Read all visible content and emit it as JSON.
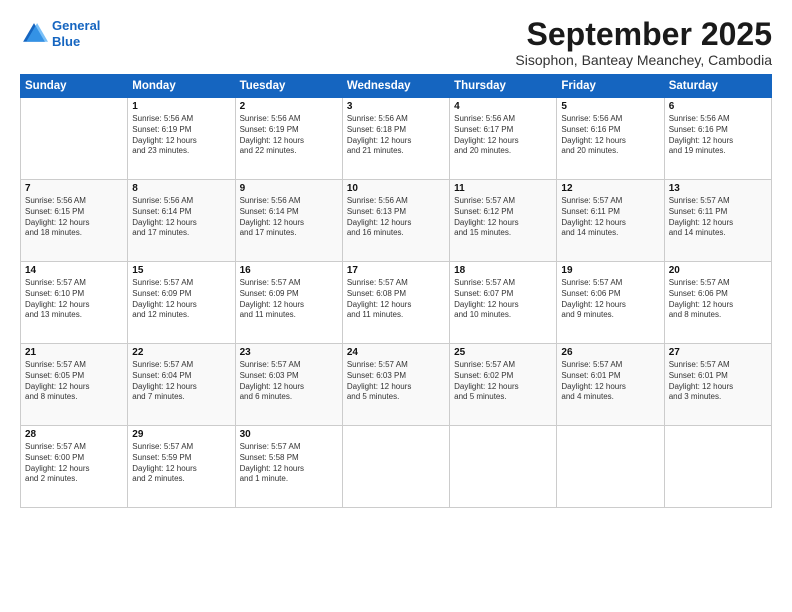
{
  "logo": {
    "line1": "General",
    "line2": "Blue"
  },
  "title": "September 2025",
  "subtitle": "Sisophon, Banteay Meanchey, Cambodia",
  "days_header": [
    "Sunday",
    "Monday",
    "Tuesday",
    "Wednesday",
    "Thursday",
    "Friday",
    "Saturday"
  ],
  "weeks": [
    [
      {
        "day": "",
        "info": ""
      },
      {
        "day": "1",
        "info": "Sunrise: 5:56 AM\nSunset: 6:19 PM\nDaylight: 12 hours\nand 23 minutes."
      },
      {
        "day": "2",
        "info": "Sunrise: 5:56 AM\nSunset: 6:19 PM\nDaylight: 12 hours\nand 22 minutes."
      },
      {
        "day": "3",
        "info": "Sunrise: 5:56 AM\nSunset: 6:18 PM\nDaylight: 12 hours\nand 21 minutes."
      },
      {
        "day": "4",
        "info": "Sunrise: 5:56 AM\nSunset: 6:17 PM\nDaylight: 12 hours\nand 20 minutes."
      },
      {
        "day": "5",
        "info": "Sunrise: 5:56 AM\nSunset: 6:16 PM\nDaylight: 12 hours\nand 20 minutes."
      },
      {
        "day": "6",
        "info": "Sunrise: 5:56 AM\nSunset: 6:16 PM\nDaylight: 12 hours\nand 19 minutes."
      }
    ],
    [
      {
        "day": "7",
        "info": "Sunrise: 5:56 AM\nSunset: 6:15 PM\nDaylight: 12 hours\nand 18 minutes."
      },
      {
        "day": "8",
        "info": "Sunrise: 5:56 AM\nSunset: 6:14 PM\nDaylight: 12 hours\nand 17 minutes."
      },
      {
        "day": "9",
        "info": "Sunrise: 5:56 AM\nSunset: 6:14 PM\nDaylight: 12 hours\nand 17 minutes."
      },
      {
        "day": "10",
        "info": "Sunrise: 5:56 AM\nSunset: 6:13 PM\nDaylight: 12 hours\nand 16 minutes."
      },
      {
        "day": "11",
        "info": "Sunrise: 5:57 AM\nSunset: 6:12 PM\nDaylight: 12 hours\nand 15 minutes."
      },
      {
        "day": "12",
        "info": "Sunrise: 5:57 AM\nSunset: 6:11 PM\nDaylight: 12 hours\nand 14 minutes."
      },
      {
        "day": "13",
        "info": "Sunrise: 5:57 AM\nSunset: 6:11 PM\nDaylight: 12 hours\nand 14 minutes."
      }
    ],
    [
      {
        "day": "14",
        "info": "Sunrise: 5:57 AM\nSunset: 6:10 PM\nDaylight: 12 hours\nand 13 minutes."
      },
      {
        "day": "15",
        "info": "Sunrise: 5:57 AM\nSunset: 6:09 PM\nDaylight: 12 hours\nand 12 minutes."
      },
      {
        "day": "16",
        "info": "Sunrise: 5:57 AM\nSunset: 6:09 PM\nDaylight: 12 hours\nand 11 minutes."
      },
      {
        "day": "17",
        "info": "Sunrise: 5:57 AM\nSunset: 6:08 PM\nDaylight: 12 hours\nand 11 minutes."
      },
      {
        "day": "18",
        "info": "Sunrise: 5:57 AM\nSunset: 6:07 PM\nDaylight: 12 hours\nand 10 minutes."
      },
      {
        "day": "19",
        "info": "Sunrise: 5:57 AM\nSunset: 6:06 PM\nDaylight: 12 hours\nand 9 minutes."
      },
      {
        "day": "20",
        "info": "Sunrise: 5:57 AM\nSunset: 6:06 PM\nDaylight: 12 hours\nand 8 minutes."
      }
    ],
    [
      {
        "day": "21",
        "info": "Sunrise: 5:57 AM\nSunset: 6:05 PM\nDaylight: 12 hours\nand 8 minutes."
      },
      {
        "day": "22",
        "info": "Sunrise: 5:57 AM\nSunset: 6:04 PM\nDaylight: 12 hours\nand 7 minutes."
      },
      {
        "day": "23",
        "info": "Sunrise: 5:57 AM\nSunset: 6:03 PM\nDaylight: 12 hours\nand 6 minutes."
      },
      {
        "day": "24",
        "info": "Sunrise: 5:57 AM\nSunset: 6:03 PM\nDaylight: 12 hours\nand 5 minutes."
      },
      {
        "day": "25",
        "info": "Sunrise: 5:57 AM\nSunset: 6:02 PM\nDaylight: 12 hours\nand 5 minutes."
      },
      {
        "day": "26",
        "info": "Sunrise: 5:57 AM\nSunset: 6:01 PM\nDaylight: 12 hours\nand 4 minutes."
      },
      {
        "day": "27",
        "info": "Sunrise: 5:57 AM\nSunset: 6:01 PM\nDaylight: 12 hours\nand 3 minutes."
      }
    ],
    [
      {
        "day": "28",
        "info": "Sunrise: 5:57 AM\nSunset: 6:00 PM\nDaylight: 12 hours\nand 2 minutes."
      },
      {
        "day": "29",
        "info": "Sunrise: 5:57 AM\nSunset: 5:59 PM\nDaylight: 12 hours\nand 2 minutes."
      },
      {
        "day": "30",
        "info": "Sunrise: 5:57 AM\nSunset: 5:58 PM\nDaylight: 12 hours\nand 1 minute."
      },
      {
        "day": "",
        "info": ""
      },
      {
        "day": "",
        "info": ""
      },
      {
        "day": "",
        "info": ""
      },
      {
        "day": "",
        "info": ""
      }
    ]
  ]
}
